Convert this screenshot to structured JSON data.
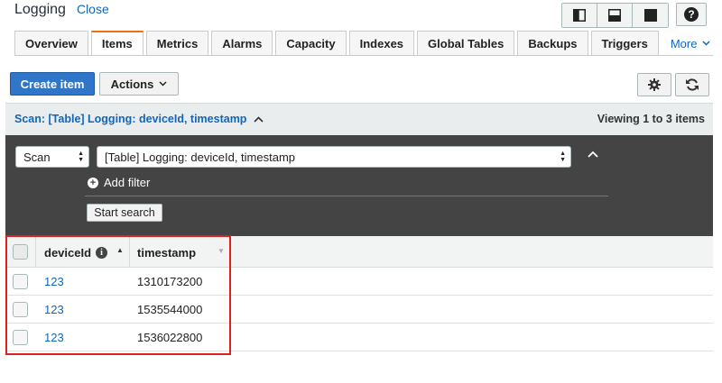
{
  "header": {
    "title": "Logging",
    "close_label": "Close"
  },
  "view_buttons": [
    {
      "icon": "split-vertical-icon"
    },
    {
      "icon": "split-horizontal-icon"
    },
    {
      "icon": "full-view-icon"
    }
  ],
  "help_label": "?",
  "tabs": [
    {
      "label": "Overview",
      "active": false
    },
    {
      "label": "Items",
      "active": true
    },
    {
      "label": "Metrics",
      "active": false
    },
    {
      "label": "Alarms",
      "active": false
    },
    {
      "label": "Capacity",
      "active": false
    },
    {
      "label": "Indexes",
      "active": false
    },
    {
      "label": "Global Tables",
      "active": false
    },
    {
      "label": "Backups",
      "active": false
    },
    {
      "label": "Triggers",
      "active": false
    }
  ],
  "more_label": "More",
  "toolbar": {
    "create_label": "Create item",
    "actions_label": "Actions"
  },
  "scan": {
    "title": "Scan: [Table] Logging: deviceId, timestamp",
    "viewing": "Viewing 1 to 3 items",
    "operation_value": "Scan",
    "target_value": "[Table] Logging: deviceId, timestamp",
    "add_filter_label": "Add filter",
    "start_label": "Start search"
  },
  "table": {
    "columns": [
      "deviceId",
      "timestamp"
    ],
    "rows": [
      {
        "deviceId": "123",
        "timestamp": "1310173200"
      },
      {
        "deviceId": "123",
        "timestamp": "1535544000"
      },
      {
        "deviceId": "123",
        "timestamp": "1536022800"
      }
    ]
  },
  "colors": {
    "accent": "#2f76c8",
    "link": "#1166bb",
    "tab_active": "#ec7211",
    "panel": "#444444",
    "highlight": "#e0201e"
  }
}
